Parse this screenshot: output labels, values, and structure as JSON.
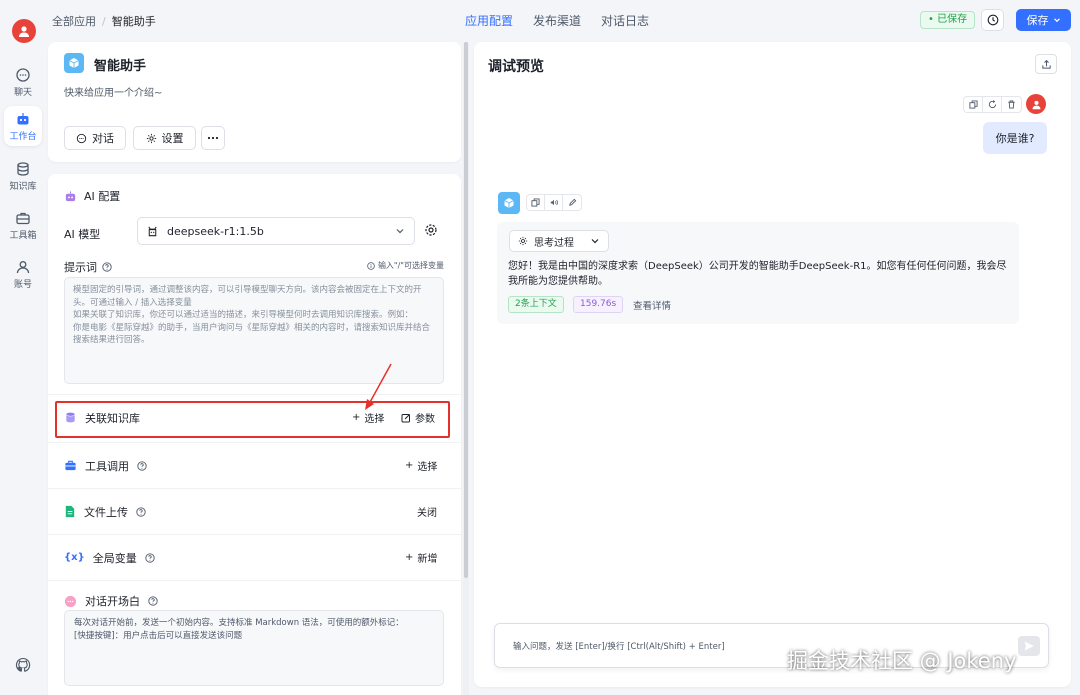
{
  "rail": {
    "items": [
      {
        "label": "聊天",
        "icon": "chat-icon"
      },
      {
        "label": "工作台",
        "icon": "robot-icon"
      },
      {
        "label": "知识库",
        "icon": "database-icon"
      },
      {
        "label": "工具箱",
        "icon": "toolbox-icon"
      },
      {
        "label": "账号",
        "icon": "user-icon"
      }
    ],
    "active": "工作台"
  },
  "header": {
    "breadcrumb": [
      "全部应用",
      "智能助手"
    ],
    "tabs": [
      "应用配置",
      "发布渠道",
      "对话日志"
    ],
    "active_tab": "应用配置",
    "saved_badge": "• 已保存",
    "save_button": "保存"
  },
  "app": {
    "name": "智能助手",
    "intro": "快来给应用一个介绍~",
    "chat_button": "对话",
    "settings_button": "设置"
  },
  "ai_config": {
    "title": "AI 配置",
    "model_label": "AI 模型",
    "model_value": "deepseek-r1:1.5b",
    "prompt_label": "提示词",
    "prompt_hint": "输入\"/\"可选择变量",
    "prompt_placeholder_1": "模型固定的引导词，通过调整该内容，可以引导模型聊天方向。该内容会被固定在上下文的开头。可通过输入 / 插入选择变量",
    "prompt_placeholder_2": "如果关联了知识库，你还可以通过适当的描述，来引导模型何时去调用知识库搜索。例如：",
    "prompt_placeholder_3": "你是电影《星际穿越》的助手，当用户询问与《星际穿越》相关的内容时，请搜索知识库并结合搜索结果进行回答。"
  },
  "sections": {
    "knowledge": {
      "title": "关联知识库",
      "select": "选择",
      "params": "参数"
    },
    "tools": {
      "title": "工具调用",
      "select": "选择"
    },
    "file_upload": {
      "title": "文件上传",
      "status": "关闭"
    },
    "variables": {
      "title": "全局变量",
      "add": "新增"
    },
    "opening": {
      "title": "对话开场白",
      "text_1": "每次对话开始前，发送一个初始内容。支持标准 Markdown 语法，可使用的额外标记：",
      "text_2": "[快捷按键]：用户点击后可以直接发送该问题"
    }
  },
  "preview": {
    "title": "调试预览",
    "user_message": "你是谁?",
    "think_label": "思考过程",
    "bot_answer": "您好！我是由中国的深度求索（DeepSeek）公司开发的智能助手DeepSeek-R1。如您有任何任何问题，我会尽我所能为您提供帮助。",
    "context_tag": "2条上下文",
    "time_tag": "159.76s",
    "details_link": "查看详情",
    "input_placeholder": "输入问题，发送 [Enter]/换行 [Ctrl(Alt/Shift) + Enter]"
  },
  "watermark": "掘金技术社区 @ Jokeny",
  "colors": {
    "accent": "#3370ff",
    "highlight": "#e4312b",
    "avatar": "#e8433a",
    "saved": "#23a04a"
  }
}
